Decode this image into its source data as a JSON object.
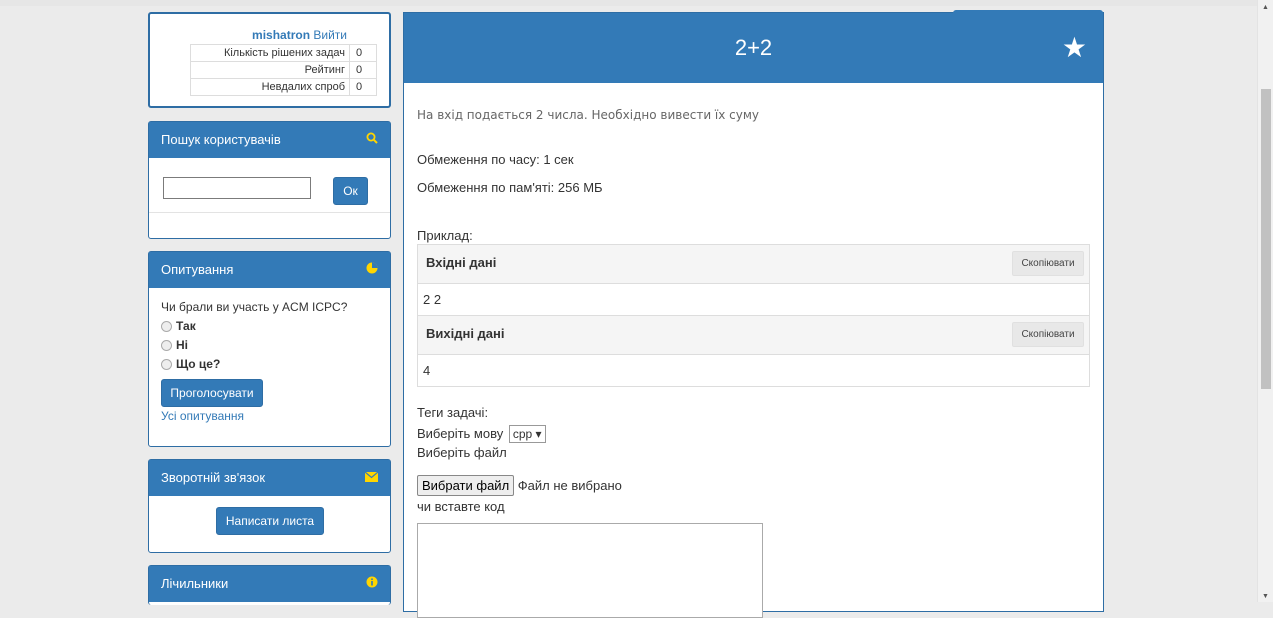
{
  "user": {
    "name": "mishatron",
    "logout": "Вийти",
    "stats": [
      {
        "label": "Кількість рішених задач",
        "value": "0"
      },
      {
        "label": "Рейтинг",
        "value": "0"
      },
      {
        "label": "Невдалих спроб",
        "value": "0"
      }
    ]
  },
  "search": {
    "title": "Пошук користувачів",
    "icon": "search-icon",
    "input_value": "",
    "button": "Ок"
  },
  "poll": {
    "title": "Опитування",
    "icon": "pie-chart-icon",
    "question": "Чи брали ви участь у ACM ICPC?",
    "options": [
      "Так",
      "Ні",
      "Що це?"
    ],
    "vote_button": "Проголосувати",
    "all_link": "Усі опитування"
  },
  "feedback": {
    "title": "Зворотній зв'язок",
    "icon": "envelope-icon",
    "button": "Написати листа"
  },
  "counters": {
    "title": "Лічильники",
    "icon": "info-icon"
  },
  "problem": {
    "title": "2+2",
    "favorite_icon": "star-icon",
    "description": "На вхід подається 2 числа. Необхідно вивести їх суму",
    "time_limit": "Обмеження по часу: 1 сек",
    "memory_limit": "Обмеження по пам'яті: 256 МБ",
    "example_label": "Приклад:",
    "input_title": "Вхідні дані",
    "input_value": "2 2",
    "output_title": "Вихідні дані",
    "output_value": "4",
    "copy_label": "Скопіювати",
    "tags_label": "Теги задачі:",
    "lang_label": "Виберіть мову",
    "lang_value": "cpp ▾",
    "choose_file_label": "Виберіть файл",
    "file_button": "Вибрати файл",
    "file_status": "Файл не вибрано",
    "paste_label": "чи вставте код"
  }
}
